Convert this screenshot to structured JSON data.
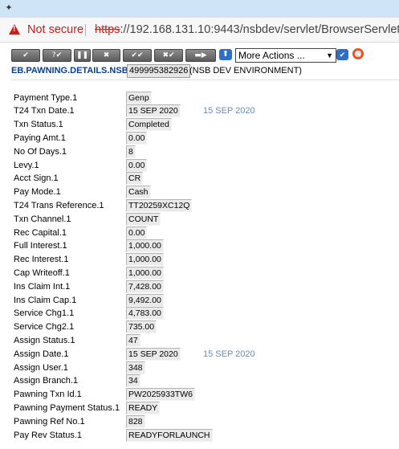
{
  "browser": {
    "security_label": "Not secure",
    "url_scheme": "https",
    "url_rest": "://192.168.131.10:9443/nsbdev/servlet/BrowserServlet"
  },
  "toolbar": {
    "more_actions": "More Actions ...",
    "buttons": [
      {
        "icon": "commit-icon",
        "glyph": "✔"
      },
      {
        "icon": "validate-icon",
        "glyph": "?✔"
      },
      {
        "icon": "hold-icon",
        "glyph": "❚❚"
      },
      {
        "icon": "delete-icon",
        "glyph": "✖"
      },
      {
        "icon": "authorise-icon",
        "glyph": "✔✔"
      },
      {
        "icon": "reverse-icon",
        "glyph": "✖✔"
      },
      {
        "icon": "next-icon",
        "glyph": "▬▶"
      }
    ]
  },
  "header": {
    "application": "EB.PAWNING.DETAILS.NSB",
    "record_id": "499995382926",
    "environment": "(NSB DEV ENVIRONMENT)"
  },
  "fields": [
    {
      "label": "Payment Type.1",
      "value": "Genp"
    },
    {
      "label": "T24 Txn Date.1",
      "value": "15 SEP 2020",
      "enrichment": "15 SEP 2020"
    },
    {
      "label": "Txn Status.1",
      "value": "Completed"
    },
    {
      "label": "Paying Amt.1",
      "value": "0.00"
    },
    {
      "label": "No Of Days.1",
      "value": "8"
    },
    {
      "label": "Levy.1",
      "value": "0.00"
    },
    {
      "label": "Acct Sign.1",
      "value": "CR"
    },
    {
      "label": "Pay Mode.1",
      "value": "Cash"
    },
    {
      "label": "T24 Trans Reference.1",
      "value": "TT20259XC12Q"
    },
    {
      "label": "Txn Channel.1",
      "value": "COUNT"
    },
    {
      "label": "Rec Capital.1",
      "value": "0.00"
    },
    {
      "label": "Full Interest.1",
      "value": "1,000.00"
    },
    {
      "label": "Rec Interest.1",
      "value": "1,000.00"
    },
    {
      "label": "Cap Writeoff.1",
      "value": "1,000.00"
    },
    {
      "label": "Ins Claim Int.1",
      "value": "7,428.00"
    },
    {
      "label": "Ins Claim Cap.1",
      "value": "9,492.00"
    },
    {
      "label": "Service Chg1.1",
      "value": "4,783.00"
    },
    {
      "label": "Service Chg2.1",
      "value": "735.00"
    },
    {
      "label": "Assign Status.1",
      "value": "47"
    },
    {
      "label": "Assign Date.1",
      "value": "15 SEP 2020",
      "enrichment": "15 SEP 2020"
    },
    {
      "label": "Assign User.1",
      "value": "348"
    },
    {
      "label": "Assign Branch.1",
      "value": "34"
    },
    {
      "label": "Pawning Txn Id.1",
      "value": "PW2025933TW6"
    },
    {
      "label": "Pawning Payment Status.1",
      "value": "READY"
    },
    {
      "label": "Pawning Ref No.1",
      "value": "828"
    },
    {
      "label": "Pay Rev Status.1",
      "value": "READYFORLAUNCH"
    }
  ]
}
